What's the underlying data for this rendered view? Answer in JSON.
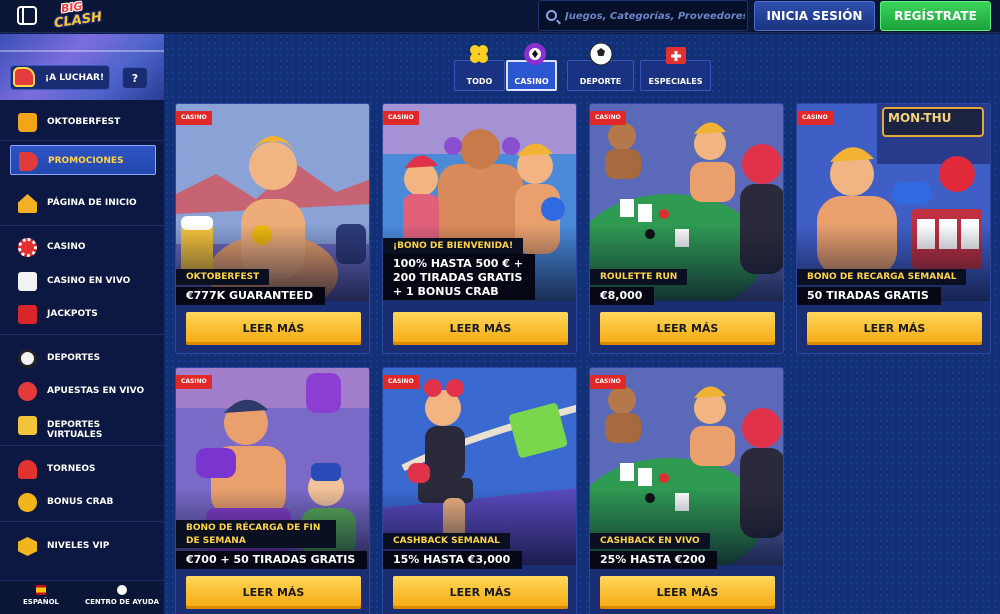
{
  "header": {
    "logo_line1": "BIG",
    "logo_line2": "CLASH",
    "search_placeholder": "Juegos, Categorías, Proveedores",
    "login_label": "INICIA SESIÓN",
    "register_label": "REGÍSTRATE"
  },
  "sidebar": {
    "fight_label": "¡A LUCHAR!",
    "help_label": "?",
    "items": [
      {
        "label": "OKTOBERFEST",
        "icon": "beer-mug-icon"
      },
      {
        "label": "PROMOCIONES",
        "icon": "megaphone-icon",
        "active": true
      },
      {
        "label": "PÁGINA DE INICIO",
        "icon": "home-icon"
      },
      {
        "label": "CASINO",
        "icon": "poker-chip-icon"
      },
      {
        "label": "CASINO EN VIVO",
        "icon": "dice-icon"
      },
      {
        "label": "JACKPOTS",
        "icon": "sevens-icon"
      },
      {
        "label": "DEPORTES",
        "icon": "soccer-ball-icon"
      },
      {
        "label": "APUESTAS EN VIVO",
        "icon": "live-play-icon"
      },
      {
        "label": "DEPORTES VIRTUALES",
        "icon": "virtual-ticket-icon"
      },
      {
        "label": "TORNEOS",
        "icon": "trophy-icon"
      },
      {
        "label": "BONUS CRAB",
        "icon": "crab-coin-icon"
      },
      {
        "label": "NIVELES VIP",
        "icon": "vip-badge-icon"
      }
    ],
    "footer": {
      "language_label": "ESPAÑOL",
      "help_center_label": "CENTRO DE AYUDA"
    }
  },
  "tabs": [
    {
      "label": "TODO",
      "icon": "clover-icon"
    },
    {
      "label": "CASINO",
      "icon": "poker-chip-icon",
      "active": true
    },
    {
      "label": "DEPORTE",
      "icon": "soccer-ball-icon"
    },
    {
      "label": "ESPECIALES",
      "icon": "first-aid-icon"
    }
  ],
  "cards": [
    {
      "badge": "CASINO",
      "ribbon": "OKTOBERFEST",
      "offer": "€777K GUARANTEED",
      "button": "LEER MÁS"
    },
    {
      "badge": "CASINO",
      "ribbon": "¡BONO DE BIENVENIDA!",
      "offer": "100% HASTA 500 € +\n200 TIRADAS GRATIS\n+ 1 BONUS CRAB",
      "button": "LEER MÁS"
    },
    {
      "badge": "CASINO",
      "ribbon": "ROULETTE RUN",
      "offer": "€8,000",
      "button": "LEER MÁS"
    },
    {
      "badge": "CASINO",
      "ribbon": "BONO DE RECARGA SEMANAL",
      "offer": "50 TIRADAS GRATIS",
      "button": "LEER MÁS",
      "sign": "MON-THU"
    },
    {
      "badge": "CASINO",
      "ribbon": "BONO DE RÉCARGA DE FIN DE SEMANA",
      "offer": "€700 + 50 TIRADAS GRATIS",
      "button": "LEER MÁS"
    },
    {
      "badge": "CASINO",
      "ribbon": "CASHBACK SEMANAL",
      "offer": "15% HASTA €3,000",
      "button": "LEER MÁS"
    },
    {
      "badge": "CASINO",
      "ribbon": "CASHBACK EN VIVO",
      "offer": "25% HASTA €200",
      "button": "LEER MÁS"
    }
  ],
  "colors": {
    "accent_yellow": "#ffd447",
    "badge_red": "#e02a2a",
    "register_green": "#2bc24a",
    "login_blue": "#2546a0"
  }
}
